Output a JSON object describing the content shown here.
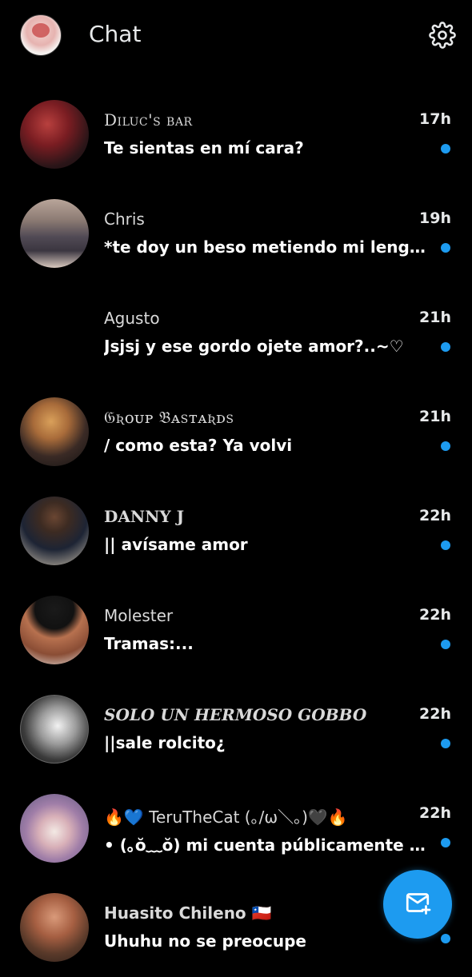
{
  "header": {
    "title": "Chat"
  },
  "conversations": [
    {
      "name": "Diluc's bar",
      "time": "17h",
      "message": "Te sientas en mí cara?"
    },
    {
      "name": "Chris",
      "time": "19h",
      "message": "*te doy un beso metiendo mi lengua..."
    },
    {
      "name": "Agusto",
      "time": "21h",
      "message": "Jsjsj y ese gordo ojete amor?..~♡"
    },
    {
      "name": "𝔊ʀᴏᴜᴘ 𝔅ᴀsᴛᴀʀᴅs",
      "time": "21h",
      "message": "/ como esta? Ya volvi"
    },
    {
      "name": "DANNY J",
      "time": "22h",
      "message": "|| avísame amor"
    },
    {
      "name": "Molester",
      "time": "22h",
      "message": "Tramas:..."
    },
    {
      "name": "SOLO UN HERMOSO GOBBO",
      "time": "22h",
      "message": "||sale rolcito¿"
    },
    {
      "name": "🔥💙 TeruTheCat (｡/ω＼｡)🖤🔥",
      "time": "22h",
      "message": "• (｡ŏ﹏ŏ) mi cuenta públicamente es..."
    },
    {
      "name": "Huasito Chileno 🇨🇱",
      "time": "",
      "message": "Uhuhu no se preocupe"
    }
  ],
  "icons": {
    "settings": "gear-icon",
    "compose": "new-message-icon",
    "unread": "unread-dot"
  },
  "colors": {
    "accent": "#1d9bf0",
    "background": "#000000"
  }
}
